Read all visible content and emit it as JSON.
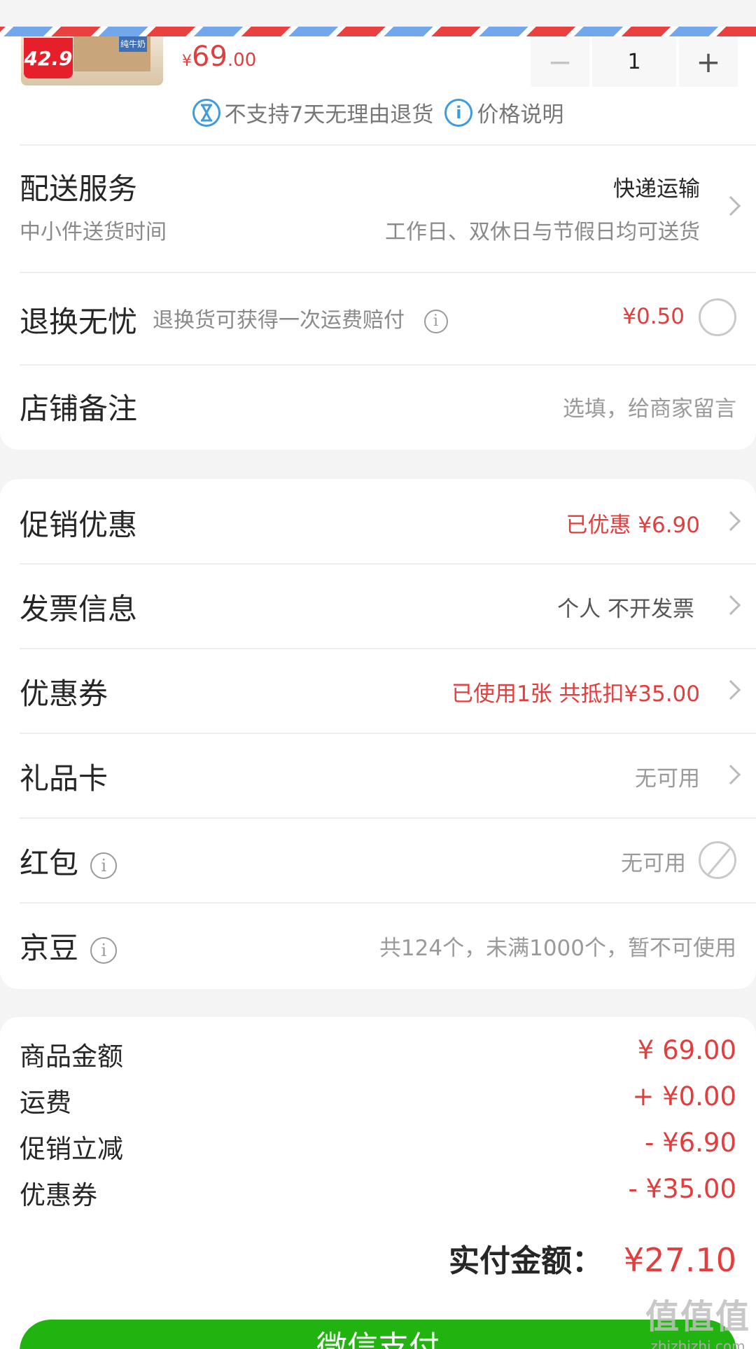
{
  "product": {
    "tag_price": "42.9",
    "brand_text": "纯牛奶",
    "price_symbol": "¥",
    "price_int": "69",
    "price_dec": ".00",
    "quantity": "1",
    "minus": "−",
    "plus": "+"
  },
  "notices": {
    "no_return_icon": "no-return-icon",
    "no_return": "不支持7天无理由退货",
    "info_icon": "i",
    "price_note": "价格说明"
  },
  "delivery": {
    "label": "配送服务",
    "value": "快递运输",
    "sub_label": "中小件送货时间",
    "sub_value": "工作日、双休日与节假日均可送货"
  },
  "return_insurance": {
    "label": "退换无忧",
    "desc": "退换货可获得一次运费赔付",
    "price": "¥0.50"
  },
  "shop_note": {
    "label": "店铺备注",
    "placeholder": "选填，给商家留言"
  },
  "promotion": {
    "label": "促销优惠",
    "value": "已优惠 ¥6.90"
  },
  "invoice": {
    "label": "发票信息",
    "value": "个人 不开发票"
  },
  "coupon": {
    "label": "优惠券",
    "value": "已使用1张 共抵扣¥35.00"
  },
  "gift_card": {
    "label": "礼品卡",
    "value": "无可用"
  },
  "red_packet": {
    "label": "红包",
    "value": "无可用"
  },
  "jd_beans": {
    "label": "京豆",
    "value": "共124个，未满1000个，暂不可使用"
  },
  "summary": [
    {
      "label": "商品金额",
      "value": "¥ 69.00"
    },
    {
      "label": "运费",
      "value": "+ ¥0.00"
    },
    {
      "label": "促销立减",
      "value": "- ¥6.90"
    },
    {
      "label": "优惠券",
      "value": "- ¥35.00"
    }
  ],
  "total": {
    "label": "实付金额：",
    "value": "¥27.10"
  },
  "pay_button": "微信支付",
  "watermark": {
    "big": "值值值",
    "small": "zhizhizhi.com"
  },
  "colors": {
    "accent_red": "#e33e3e",
    "pay_green": "#21b30f",
    "airmail_red": "#e94040",
    "airmail_blue": "#73a7ec"
  }
}
